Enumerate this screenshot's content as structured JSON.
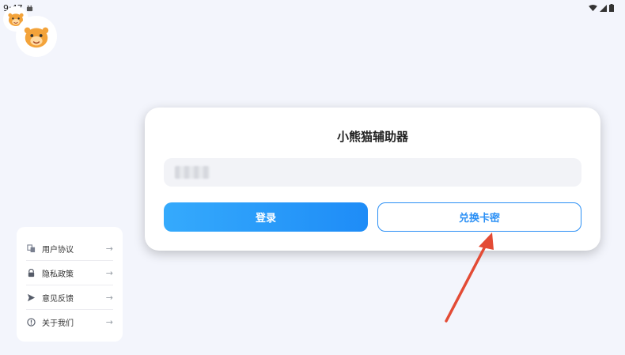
{
  "status_bar": {
    "time": "9:47"
  },
  "card": {
    "title": "小熊猫辅助器",
    "input_value": "",
    "login_label": "登录",
    "redeem_label": "兑换卡密"
  },
  "menu": {
    "items": [
      {
        "label": "用户协议",
        "icon": "document-icon"
      },
      {
        "label": "隐私政策",
        "icon": "lock-icon"
      },
      {
        "label": "意见反馈",
        "icon": "send-icon"
      },
      {
        "label": "关于我们",
        "icon": "info-icon"
      }
    ]
  },
  "colors": {
    "accent": "#2a8ff5",
    "background": "#f3f5fc",
    "annotation": "#e34b35"
  }
}
